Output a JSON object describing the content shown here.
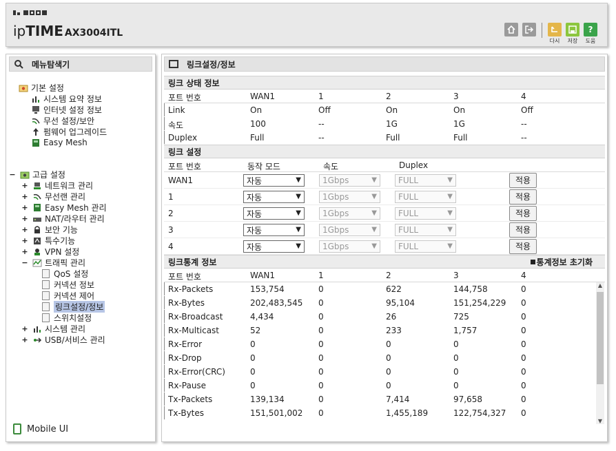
{
  "header": {
    "brand_ip": "ip",
    "brand_time": "TIME",
    "model": "AX3004ITL",
    "actions": [
      {
        "label": "다시",
        "icon": "undo-icon",
        "color": "#e4b64a"
      },
      {
        "label": "저장",
        "icon": "save-icon",
        "color": "#8cc63e"
      },
      {
        "label": "도움",
        "icon": "help-icon",
        "color": "#3aa34a"
      }
    ]
  },
  "sidebar": {
    "title": "메뉴탐색기",
    "basic_group": "기본 설정",
    "basic_items": [
      "시스템 요약 정보",
      "인터넷 설정 정보",
      "무선 설정/보안",
      "펌웨어 업그레이드",
      "Easy Mesh"
    ],
    "advanced_group": "고급 설정",
    "advanced_items": [
      "네트워크 관리",
      "무선랜 관리",
      "Easy Mesh 관리",
      "NAT/라우터 관리",
      "보안 기능",
      "특수기능",
      "VPN 설정",
      "트래픽 관리"
    ],
    "traffic_items": [
      "QoS 설정",
      "커넥션 정보",
      "커넥션 제어",
      "링크설정/정보",
      "스위치설정"
    ],
    "tail_items": [
      "시스템 관리",
      "USB/서비스 관리"
    ],
    "mobile_label": "Mobile UI"
  },
  "main": {
    "title": "링크설정/정보",
    "status": {
      "title": "링크 상태 정보",
      "headers": [
        "포트 번호",
        "WAN1",
        "1",
        "2",
        "3",
        "4"
      ],
      "rows": [
        [
          "Link",
          "On",
          "Off",
          "On",
          "On",
          "Off"
        ],
        [
          "속도",
          "100",
          "--",
          "1G",
          "1G",
          "--"
        ],
        [
          "Duplex",
          "Full",
          "--",
          "Full",
          "Full",
          "--"
        ]
      ]
    },
    "settings": {
      "title": "링크 설정",
      "headers": [
        "포트 번호",
        "동작 모드",
        "속도",
        "Duplex"
      ],
      "rows": [
        {
          "port": "WAN1",
          "mode": "자동",
          "speed": "1Gbps",
          "duplex": "FULL",
          "apply": "적용"
        },
        {
          "port": "1",
          "mode": "자동",
          "speed": "1Gbps",
          "duplex": "FULL",
          "apply": "적용"
        },
        {
          "port": "2",
          "mode": "자동",
          "speed": "1Gbps",
          "duplex": "FULL",
          "apply": "적용"
        },
        {
          "port": "3",
          "mode": "자동",
          "speed": "1Gbps",
          "duplex": "FULL",
          "apply": "적용"
        },
        {
          "port": "4",
          "mode": "자동",
          "speed": "1Gbps",
          "duplex": "FULL",
          "apply": "적용"
        }
      ]
    },
    "stats": {
      "title": "링크통계 정보",
      "reset_label": "통계정보 초기화",
      "headers": [
        "포트 번호",
        "WAN1",
        "1",
        "2",
        "3",
        "4"
      ],
      "rows": [
        [
          "Rx-Packets",
          "153,754",
          "0",
          "622",
          "144,758",
          "0"
        ],
        [
          "Rx-Bytes",
          "202,483,545",
          "0",
          "95,104",
          "151,254,229",
          "0"
        ],
        [
          "Rx-Broadcast",
          "4,434",
          "0",
          "26",
          "725",
          "0"
        ],
        [
          "Rx-Multicast",
          "52",
          "0",
          "233",
          "1,757",
          "0"
        ],
        [
          "Rx-Error",
          "0",
          "0",
          "0",
          "0",
          "0"
        ],
        [
          "Rx-Drop",
          "0",
          "0",
          "0",
          "0",
          "0"
        ],
        [
          "Rx-Error(CRC)",
          "0",
          "0",
          "0",
          "0",
          "0"
        ],
        [
          "Rx-Pause",
          "0",
          "0",
          "0",
          "0",
          "0"
        ],
        [
          "Tx-Packets",
          "139,134",
          "0",
          "7,414",
          "97,658",
          "0"
        ],
        [
          "Tx-Bytes",
          "151,501,002",
          "0",
          "1,455,189",
          "122,754,327",
          "0"
        ]
      ]
    }
  }
}
